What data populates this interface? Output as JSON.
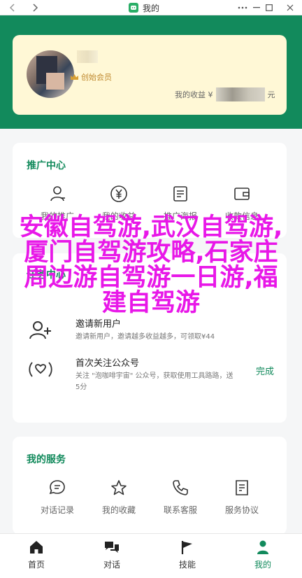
{
  "window": {
    "title": "我的",
    "back_icon": "chevron-left-icon",
    "forward_icon": "chevron-right-icon"
  },
  "profile": {
    "level": "创始会员",
    "revenue_label": "我的收益 ¥",
    "revenue_unit": "元"
  },
  "promo": {
    "title": "推广中心",
    "items": [
      {
        "label": "我的推广",
        "icon": "user-icon"
      },
      {
        "label": "我的收益",
        "icon": "yen-icon"
      },
      {
        "label": "推广海报",
        "icon": "poster-icon"
      },
      {
        "label": "收款信息",
        "icon": "wallet-icon"
      }
    ]
  },
  "tasks": {
    "title": "任务中心",
    "rows": [
      {
        "title": "邀请新用户",
        "desc": "邀请新用户，邀请越多收益越多，可领取¥44",
        "action": ""
      },
      {
        "title": "首次关注公众号",
        "desc": "关注 \"泡咖啡宇宙\" 公众号，获取使用工具路路，送5分",
        "action": "完成"
      }
    ]
  },
  "services": {
    "title": "我的服务",
    "items": [
      {
        "label": "对话记录",
        "icon": "chat-icon"
      },
      {
        "label": "我的收藏",
        "icon": "star-icon"
      },
      {
        "label": "联系客服",
        "icon": "phone-icon"
      },
      {
        "label": "服务协议",
        "icon": "document-icon"
      }
    ]
  },
  "overlay_text": "安徽自驾游,武汉自驾游,厦门自驾游攻略,石家庄周边游自驾游一日游,福建自驾游",
  "nav": [
    {
      "label": "首页",
      "icon": "home-icon"
    },
    {
      "label": "对话",
      "icon": "chat-bubbles-icon"
    },
    {
      "label": "技能",
      "icon": "flag-icon"
    },
    {
      "label": "我的",
      "icon": "person-icon"
    }
  ],
  "colors": {
    "brand": "#128a5c",
    "overlay": "#e817e8",
    "card_bg": "#fff8d6"
  }
}
